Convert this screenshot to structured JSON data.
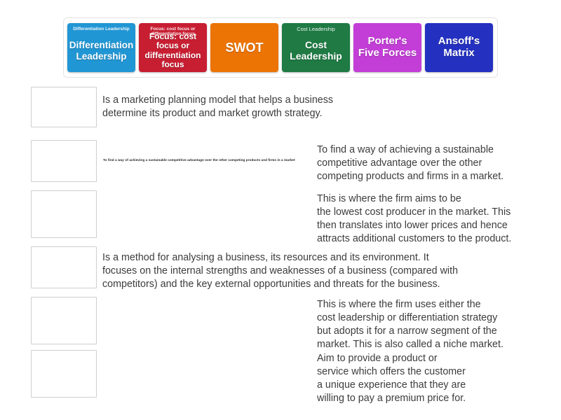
{
  "activity": {
    "type": "match-up-drag-and-drop",
    "tray": {
      "tiles": [
        {
          "label": "Differentiation\nLeadership",
          "ghost": "Differentiation Leadership",
          "color": "#2196d4",
          "name": "tile-differentiation-leadership"
        },
        {
          "label": "Focus: cost focus\nor differentiation\nfocus",
          "ghost": "Focus: cost focus or differentiation focus",
          "color": "#c81e32",
          "name": "tile-focus"
        },
        {
          "label": "SWOT",
          "ghost": "",
          "color": "#ec7404",
          "name": "tile-swot"
        },
        {
          "label": "Cost\nLeadership",
          "ghost": "Cost Leadership",
          "color": "#1f7a44",
          "name": "tile-cost-leadership"
        },
        {
          "label": "Porter's\nFive Forces",
          "ghost": "",
          "color": "#c23ed6",
          "name": "tile-porters-five-forces"
        },
        {
          "label": "Ansoff's\nMatrix",
          "ghost": "",
          "color": "#2431c0",
          "name": "tile-ansoffs-matrix"
        }
      ]
    },
    "rows": [
      {
        "answer": "",
        "definition": "Is a marketing planning model that helps a business\ndetermine its product and market growth strategy.",
        "ghost": "",
        "align": "left"
      },
      {
        "answer": "",
        "definition": "To find a way of achieving a sustainable\ncompetitive advantage over the other\ncompeting products and firms in a market.",
        "ghost": "To find a way of achieving a sustainable competitive advantage over the other competing products and firms in a market",
        "align": "right"
      },
      {
        "answer": "",
        "definition": "This is where the firm aims to be\nthe lowest cost producer in the market. This\nthen translates into lower prices and hence\nattracts additional customers to the product.",
        "ghost": "",
        "align": "right"
      },
      {
        "answer": "",
        "definition": "Is a method for analysing a business, its resources and its environment. It\nfocuses on the internal strengths and weaknesses of a business (compared with\ncompetitors) and the key external opportunities and threats for the business.",
        "ghost": "",
        "align": "left"
      },
      {
        "answer": "",
        "definition": "This is where the firm uses either the\ncost leadership or differentiation strategy\nbut adopts it for a narrow segment of the\nmarket. This is also called a niche market.",
        "ghost": "",
        "align": "right"
      },
      {
        "answer": "",
        "definition": "Aim to provide a product or\nservice which offers the customer\na unique experience that they are\nwilling to pay a premium price for.",
        "ghost": "",
        "align": "right"
      }
    ]
  }
}
